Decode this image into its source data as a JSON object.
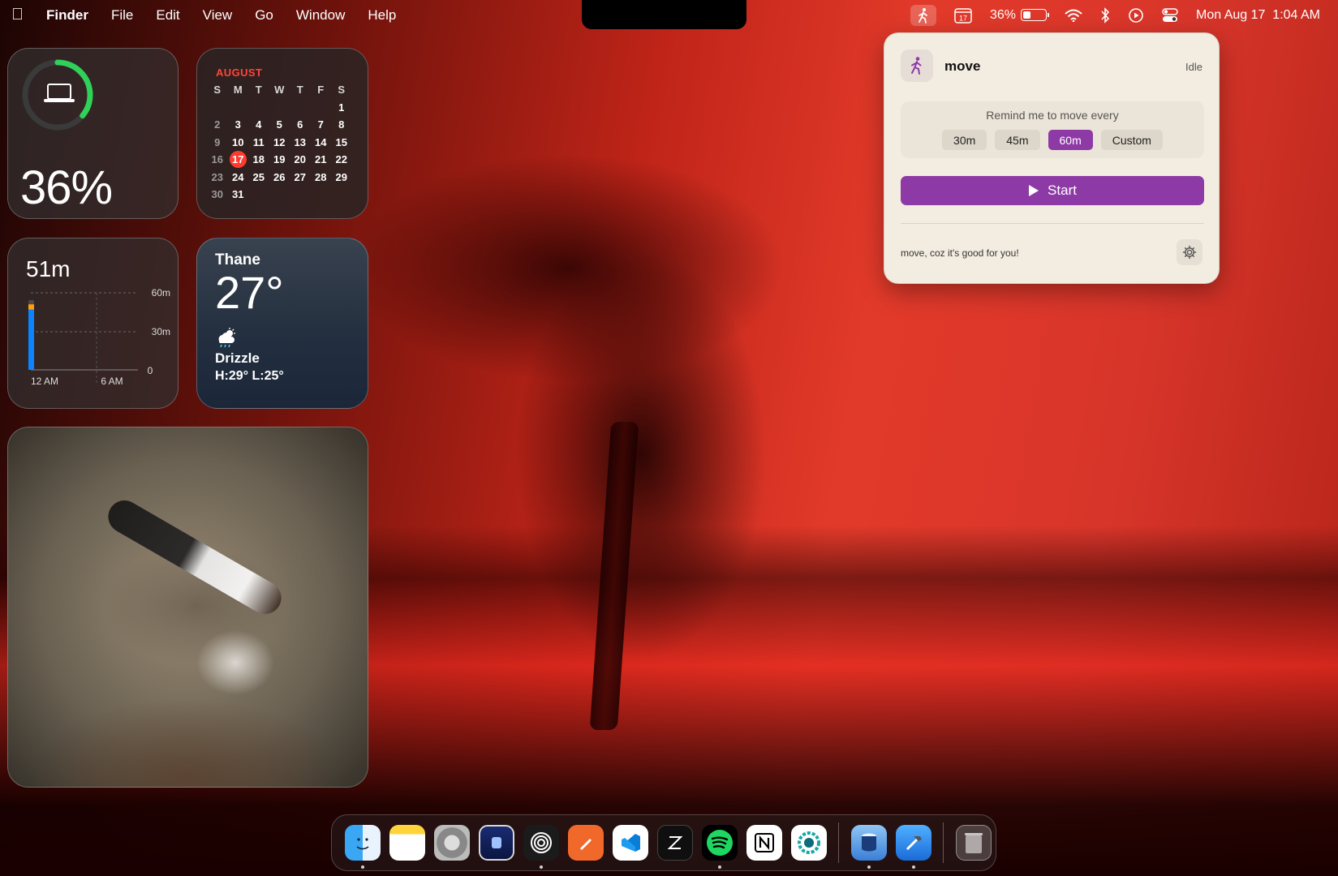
{
  "menubar": {
    "app_name": "Finder",
    "menus": [
      "File",
      "Edit",
      "View",
      "Go",
      "Window",
      "Help"
    ],
    "calendar_day": "17",
    "battery_percent": "36%",
    "battery_level": 0.36,
    "datetime": "Mon Aug 17  1:04 AM"
  },
  "widgets": {
    "battery": {
      "percent": "36%",
      "level": 0.36,
      "ring_color": "#30d158"
    },
    "calendar": {
      "month": "AUGUST",
      "weekdays": [
        "S",
        "M",
        "T",
        "W",
        "T",
        "F",
        "S"
      ],
      "weeks": [
        [
          "",
          "",
          "",
          "",
          "",
          "",
          "1"
        ],
        [
          "2",
          "3",
          "4",
          "5",
          "6",
          "7",
          "8"
        ],
        [
          "9",
          "10",
          "11",
          "12",
          "13",
          "14",
          "15"
        ],
        [
          "16",
          "17",
          "18",
          "19",
          "20",
          "21",
          "22"
        ],
        [
          "23",
          "24",
          "25",
          "26",
          "27",
          "28",
          "29"
        ],
        [
          "30",
          "31",
          "",
          "",
          "",
          "",
          ""
        ]
      ],
      "today": "17",
      "today_color": "#ff3b30"
    },
    "screen_time": {
      "total": "51m",
      "y_ticks": [
        "60m",
        "30m",
        "0"
      ],
      "x_ticks": [
        "12 AM",
        "6 AM"
      ],
      "bar_minutes_blue": 47,
      "bar_minutes_orange": 4
    },
    "weather": {
      "city": "Thane",
      "temp": "27°",
      "condition": "Drizzle",
      "hi_lo": "H:29° L:25°"
    }
  },
  "popover": {
    "title": "move",
    "status": "Idle",
    "prompt": "Remind me to move every",
    "intervals": [
      "30m",
      "45m",
      "60m",
      "Custom"
    ],
    "selected_interval": "60m",
    "start_label": "Start",
    "footer": "move, coz it's good for you!",
    "accent": "#8e3aa6"
  },
  "dock": {
    "apps": [
      "finder-icon",
      "notes-icon",
      "system-settings-icon",
      "blue-app-icon",
      "ring-app-icon",
      "pencil-app-icon",
      "vscode-icon",
      "zed-icon",
      "spotify-icon",
      "notion-icon",
      "teal-app-icon",
      "database-app-icon",
      "xcode-icon",
      "trash-icon"
    ]
  }
}
